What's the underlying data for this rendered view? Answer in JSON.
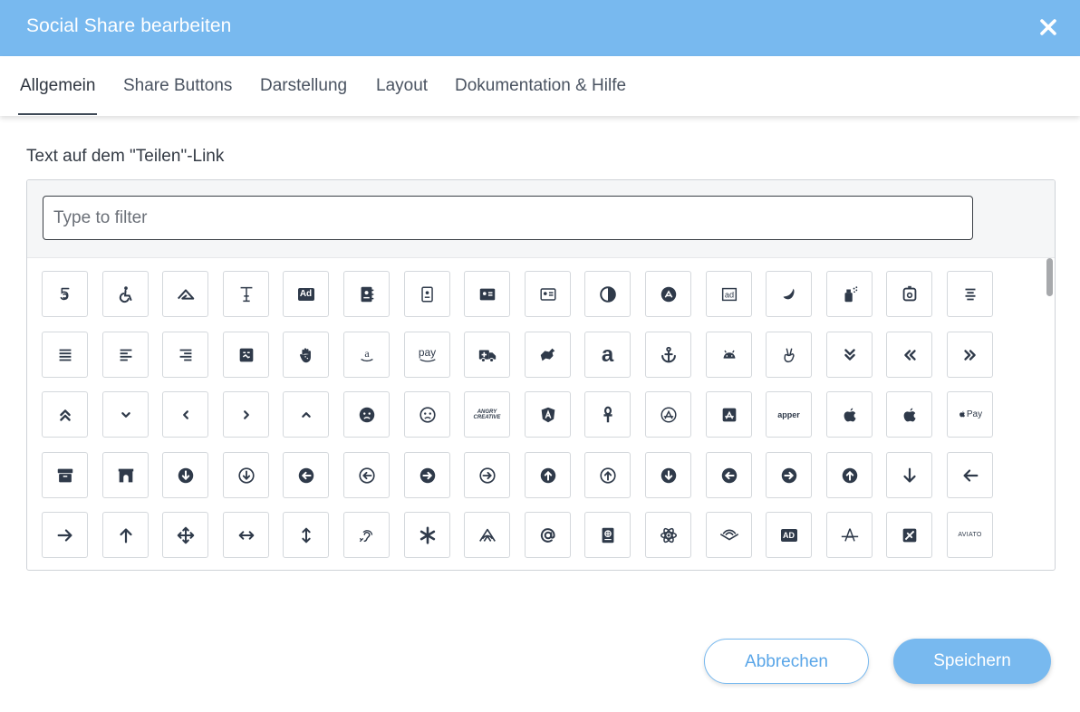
{
  "dialog": {
    "title": "Social Share bearbeiten",
    "close_icon": "close-icon",
    "accent_color": "#78b9ef"
  },
  "tabs": [
    {
      "label": "Allgemein",
      "active": true
    },
    {
      "label": "Share Buttons",
      "active": false
    },
    {
      "label": "Darstellung",
      "active": false
    },
    {
      "label": "Layout",
      "active": false
    },
    {
      "label": "Dokumentation & Hilfe",
      "active": false
    }
  ],
  "field": {
    "label": "Text auf dem \"Teilen\"-Link"
  },
  "picker": {
    "filter_placeholder": "Type to filter",
    "filter_value": "",
    "icons": [
      [
        "500px-icon",
        "accessible-icon",
        "accusoft-icon",
        "text-height-icon",
        "ad-icon",
        "address-book-icon",
        "address-book-outline-icon",
        "address-card-icon",
        "address-card-outline-icon",
        "adjust-icon",
        "adn-icon",
        "adversal-icon",
        "affiliatetheme-icon",
        "air-freshener-icon",
        "airbnb-icon",
        "align-center-icon"
      ],
      [
        "align-justify-icon",
        "align-left-icon",
        "align-right-icon",
        "allergies-icon",
        "allergies-hand-icon",
        "amazon-icon",
        "amazon-pay-icon",
        "ambulance-icon",
        "american-sign-language-icon",
        "amilia-icon",
        "anchor-icon",
        "android-icon",
        "angellist-icon",
        "angle-double-down-icon",
        "angle-double-left-icon",
        "angle-double-right-icon"
      ],
      [
        "angle-double-up-icon",
        "angle-down-icon",
        "angle-left-icon",
        "angle-right-icon",
        "angle-up-icon",
        "angry-icon",
        "angry-outline-icon",
        "angrycreative-icon",
        "angular-icon",
        "ankh-icon",
        "app-store-icon",
        "app-store-ios-icon",
        "apper-icon",
        "apple-icon",
        "apple-alt-icon",
        "apple-pay-icon"
      ],
      [
        "archive-icon",
        "archway-icon",
        "arrow-alt-circle-down-icon",
        "arrow-alt-circle-down-outline-icon",
        "arrow-alt-circle-left-icon",
        "arrow-alt-circle-left-outline-icon",
        "arrow-alt-circle-right-icon",
        "arrow-alt-circle-right-outline-icon",
        "arrow-alt-circle-up-icon",
        "arrow-alt-circle-up-outline-icon",
        "arrow-circle-down-icon",
        "arrow-circle-left-icon",
        "arrow-circle-right-icon",
        "arrow-circle-up-icon",
        "arrow-down-icon",
        "arrow-left-icon"
      ],
      [
        "arrow-right-icon",
        "arrow-up-icon",
        "arrows-alt-icon",
        "arrows-alt-h-icon",
        "arrows-alt-v-icon",
        "assistive-listening-systems-icon",
        "asterisk-icon",
        "asymmetrik-icon",
        "at-icon",
        "atlas-icon",
        "atom-icon",
        "audible-icon",
        "audio-description-icon",
        "autoprefixer-icon",
        "avianex-icon",
        "aviato-icon"
      ]
    ],
    "icon_text": {
      "ad-icon": "Ad",
      "amazon-pay-icon": "pay",
      "amilia-icon": "a",
      "angrycreative-icon": "ANGRY CREATIVE",
      "apper-icon": "apper",
      "apple-pay-icon": "Pay",
      "audio-description-icon": "AD",
      "aviato-icon": "AVIATO"
    }
  },
  "buttons": {
    "cancel": "Abbrechen",
    "save": "Speichern"
  }
}
